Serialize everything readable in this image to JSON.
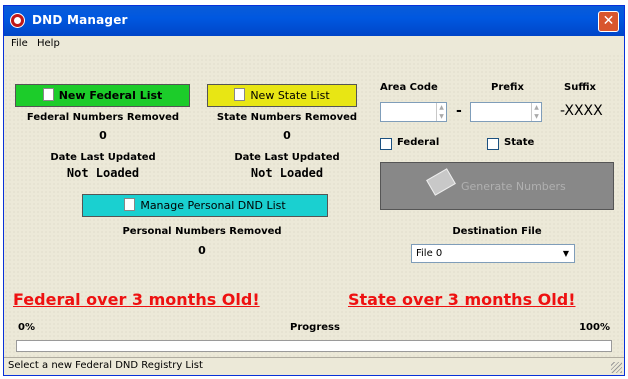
{
  "window": {
    "title": "DND Manager",
    "close_glyph": "✕"
  },
  "menu": {
    "items": [
      "File",
      "Help"
    ]
  },
  "federal": {
    "button_label": "New Federal List",
    "button_color": "#1ccc2a",
    "removed_label": "Federal Numbers Removed",
    "removed_value": "0",
    "date_label": "Date Last Updated",
    "date_value": "Not Loaded"
  },
  "state": {
    "button_label": "New State List",
    "button_color": "#e8e614",
    "removed_label": "State Numbers Removed",
    "removed_value": "0",
    "date_label": "Date Last Updated",
    "date_value": "Not Loaded"
  },
  "personal": {
    "button_label": "Manage Personal DND List",
    "button_color": "#1ad0d0",
    "removed_label": "Personal Numbers Removed",
    "removed_value": "0"
  },
  "phone": {
    "area_code_label": "Area Code",
    "prefix_label": "Prefix",
    "suffix_label": "Suffix",
    "area_code_value": "",
    "prefix_value": "",
    "dash": "-",
    "suffix_value": "-XXXX"
  },
  "options": {
    "federal_label": "Federal",
    "federal_checked": false,
    "state_label": "State",
    "state_checked": false
  },
  "generate": {
    "button_label": "Generate Numbers",
    "enabled": false
  },
  "destination": {
    "label": "Destination File",
    "selected": "File 0"
  },
  "warnings": {
    "federal": "Federal over 3 months Old!",
    "state": "State over 3 months Old!",
    "color": "#ee1111"
  },
  "progress": {
    "min_label": "0%",
    "label": "Progress",
    "max_label": "100%",
    "value": 0
  },
  "status": {
    "text": "Select a new Federal DND Registry List"
  }
}
